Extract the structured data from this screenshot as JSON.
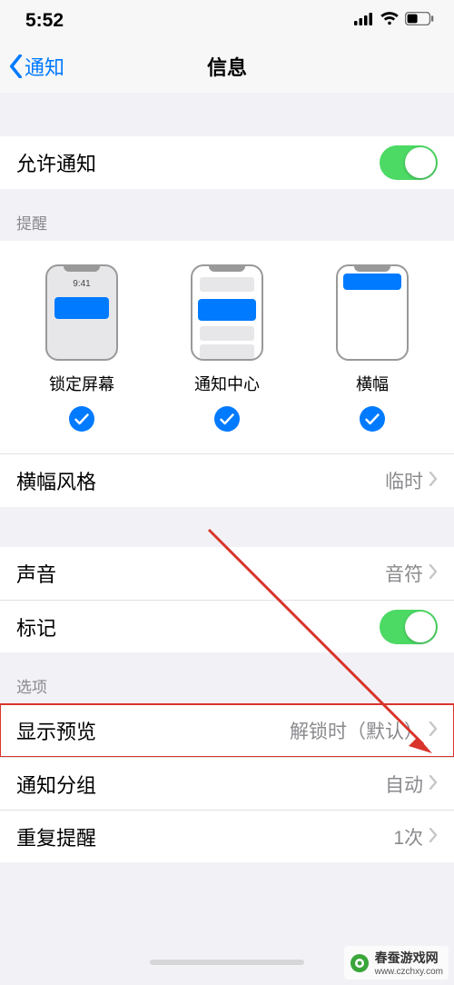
{
  "status": {
    "time": "5:52"
  },
  "nav": {
    "back": "通知",
    "title": "信息"
  },
  "allow": {
    "label": "允许通知",
    "on": true
  },
  "alertsHeader": "提醒",
  "alerts": {
    "lockTime": "9:41",
    "items": [
      {
        "label": "锁定屏幕",
        "checked": true
      },
      {
        "label": "通知中心",
        "checked": true
      },
      {
        "label": "横幅",
        "checked": true
      }
    ]
  },
  "bannerStyle": {
    "label": "横幅风格",
    "value": "临时"
  },
  "sound": {
    "label": "声音",
    "value": "音符"
  },
  "badge": {
    "label": "标记",
    "on": true
  },
  "optionsHeader": "选项",
  "showPreviews": {
    "label": "显示预览",
    "value": "解锁时（默认）"
  },
  "grouping": {
    "label": "通知分组",
    "value": "自动"
  },
  "repeat": {
    "label": "重复提醒",
    "value": "1次"
  },
  "watermark": {
    "text": "春蚕游戏网",
    "url": "www.czchxy.com"
  }
}
